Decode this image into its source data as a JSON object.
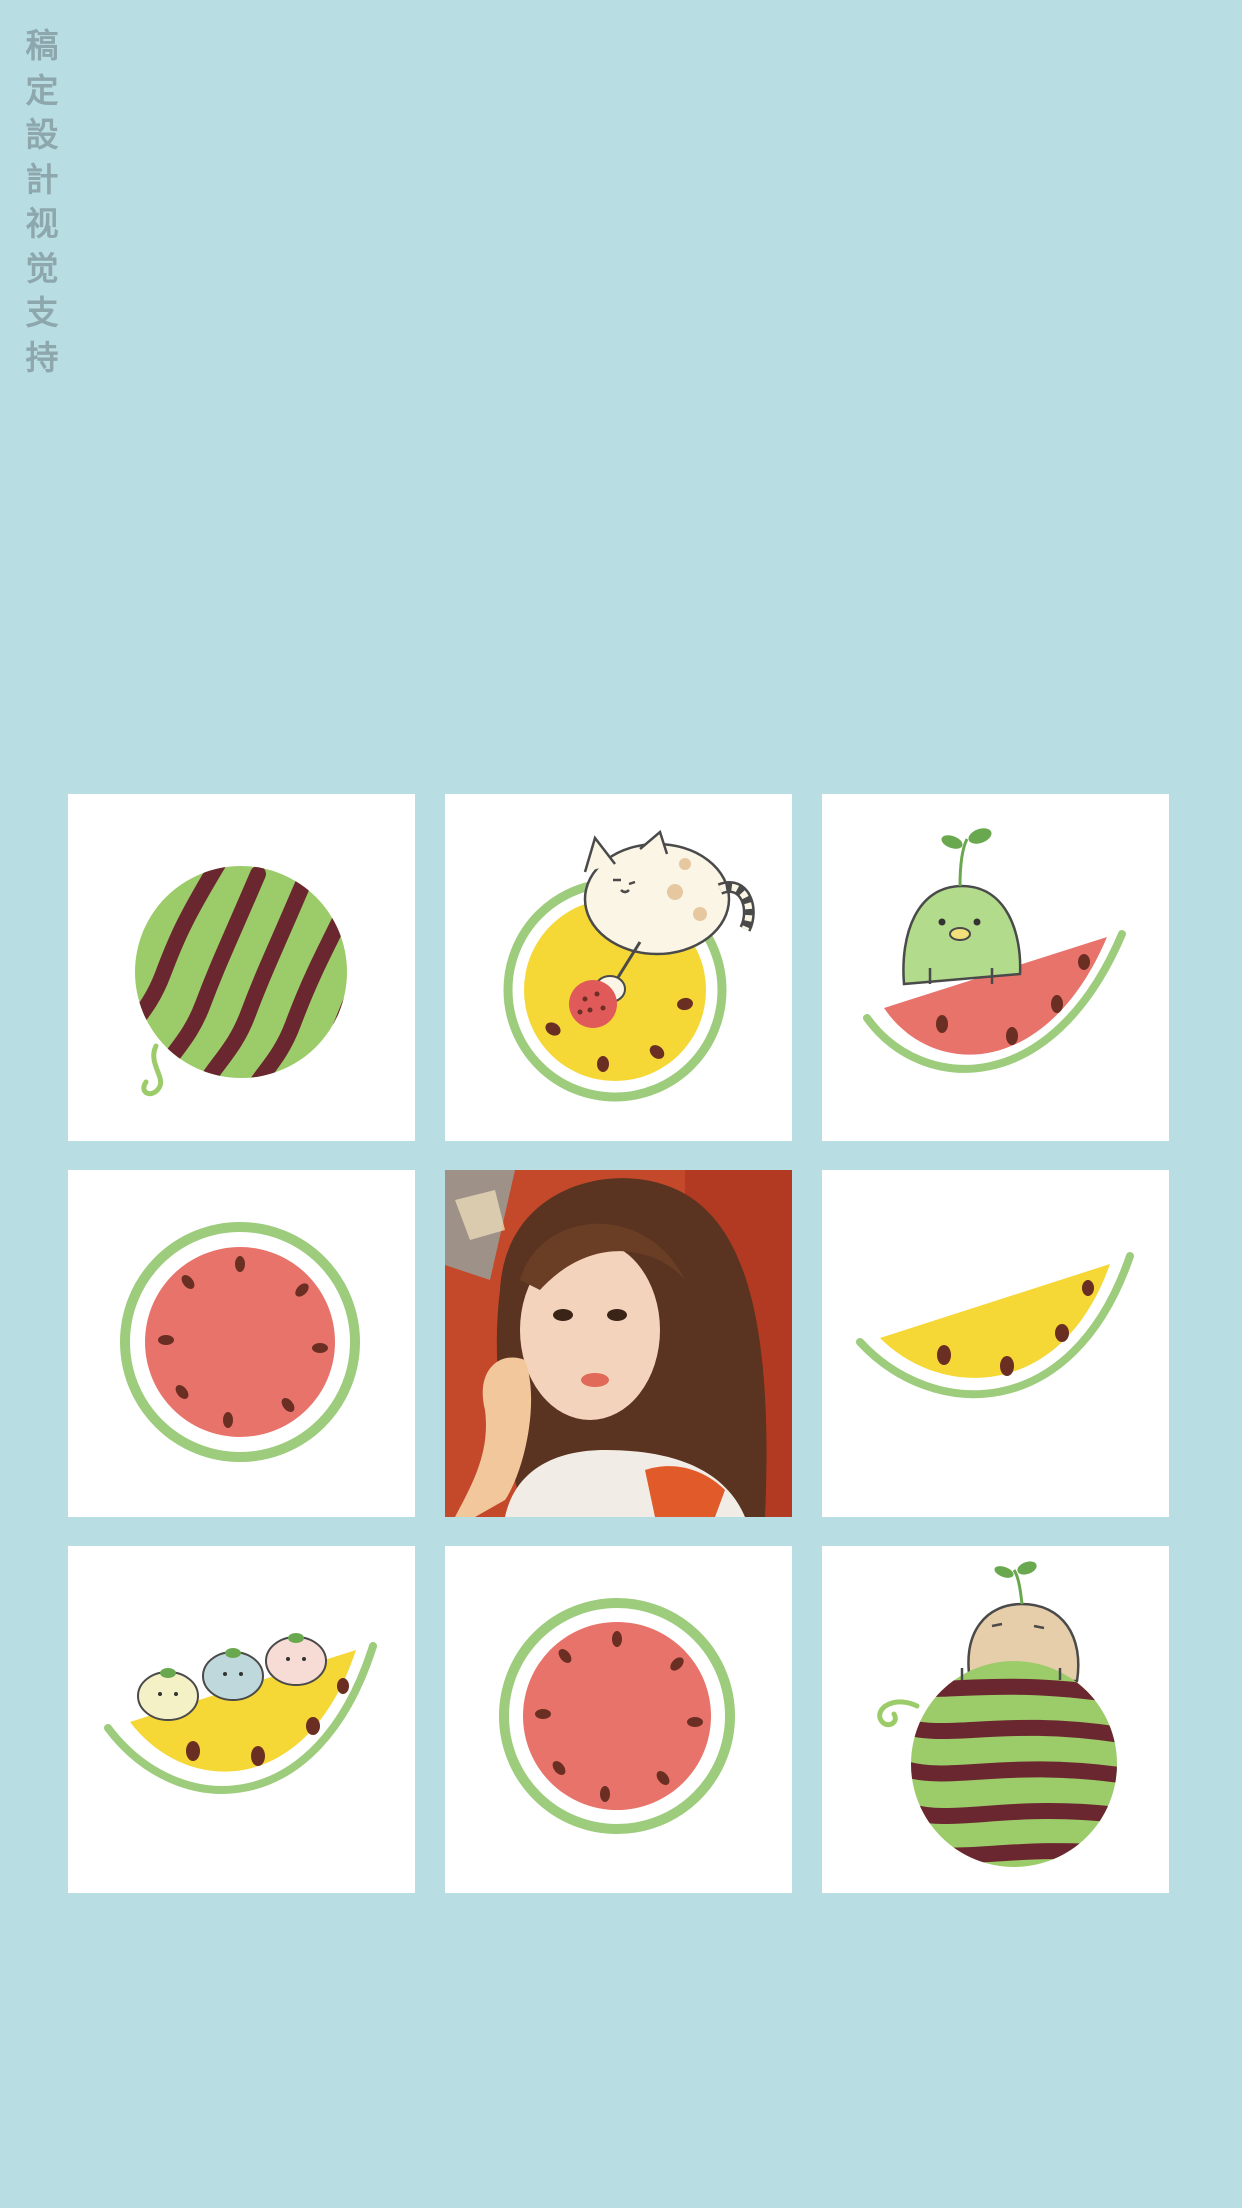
{
  "watermark": {
    "chars": [
      "稿",
      "定",
      "設",
      "計",
      "视",
      "觉",
      "支",
      "持"
    ]
  },
  "colors": {
    "background": "#b8dee4",
    "tile": "#ffffff",
    "rind_green": "#9ccc7c",
    "stripe_dark": "#6b2730",
    "flesh_red": "#e8736b",
    "flesh_yellow": "#f5d736",
    "seed": "#6b2e22"
  },
  "grid": {
    "tiles": [
      {
        "id": "whole-watermelon-tile",
        "icon": "whole-watermelon-icon"
      },
      {
        "id": "cat-yellow-watermelon-tile",
        "icon": "cat-on-yellow-watermelon-icon"
      },
      {
        "id": "green-creature-slice-tile",
        "icon": "green-creature-red-slice-icon"
      },
      {
        "id": "red-round-slice-tile",
        "icon": "red-watermelon-round-icon"
      },
      {
        "id": "center-photo-tile",
        "icon": "portrait-photo"
      },
      {
        "id": "yellow-wedge-tile",
        "icon": "yellow-watermelon-wedge-icon"
      },
      {
        "id": "yellow-wedge-critters-tile",
        "icon": "critters-yellow-wedge-icon"
      },
      {
        "id": "red-round-slice-tile-2",
        "icon": "red-watermelon-round-icon"
      },
      {
        "id": "creature-on-whole-tile",
        "icon": "creature-on-whole-watermelon-icon"
      }
    ]
  }
}
